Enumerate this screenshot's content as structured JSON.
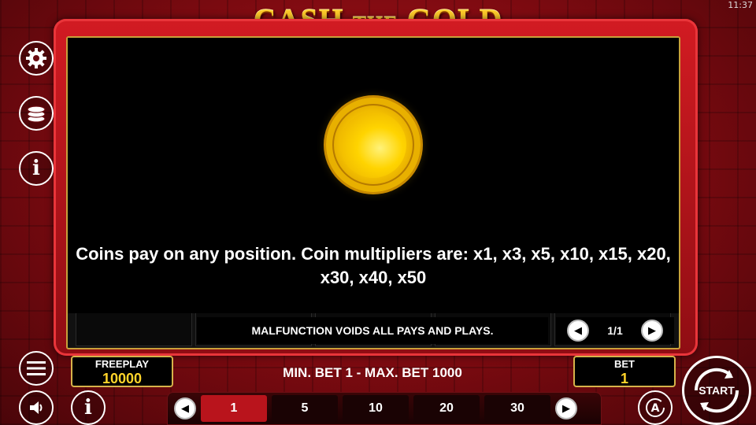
{
  "status_bar": {
    "time": "11:37"
  },
  "game": {
    "title_part1": "CASH",
    "title_part2": "THE",
    "title_part3": "GOLD"
  },
  "paytable": {
    "description": "Coins pay on any position. Coin multipliers are: x1, x3, x5, x10, x15, x20, x30, x40, x50",
    "page": "1/1",
    "prev_icon": "chevron-left-icon",
    "next_icon": "chevron-right-icon"
  },
  "footer": {
    "malfunction_notice": "MALFUNCTION VOIDS ALL PAYS AND PLAYS.",
    "freeplay_label": "FREEPLAY",
    "freeplay_value": "10000",
    "min_max_bet": "MIN. BET 1 - MAX. BET 1000",
    "bet_label": "BET",
    "bet_value": "1",
    "start_label": "START"
  },
  "bet_selector": {
    "options": [
      "1",
      "5",
      "10",
      "20",
      "30"
    ],
    "selected": "1"
  },
  "side_menu": {
    "icons": [
      "gear-icon",
      "coins-stack-icon",
      "info-icon",
      "menu-icon",
      "sound-icon",
      "info-icon"
    ]
  },
  "colors": {
    "accent_gold": "#ffd42a",
    "frame_red": "#d21b22",
    "selected_bet": "#b9141c"
  }
}
